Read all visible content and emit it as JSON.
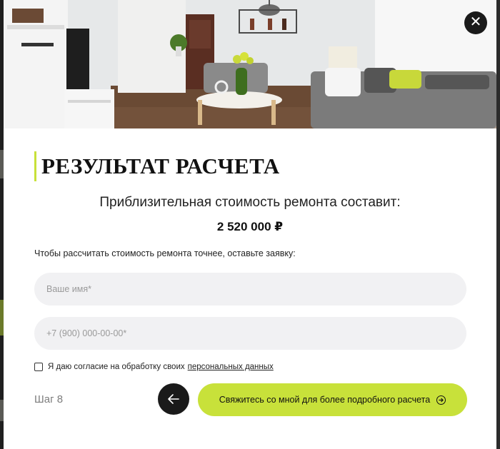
{
  "modal": {
    "title": "РЕЗУЛЬТАТ РАСЧЕТА",
    "subtitle": "Приблизительная стоимость ремонта составит:",
    "price": "2 520 000 ₽",
    "hint": "Чтобы рассчитать стоимость ремонта точнее, оставьте заявку:"
  },
  "form": {
    "name_placeholder": "Ваше имя*",
    "phone_placeholder": "+7 (900) 000-00-00*",
    "consent_text": "Я даю согласие на обработку своих",
    "consent_link": "персональных данных"
  },
  "footer": {
    "step": "Шаг 8",
    "submit_label": "Свяжитесь со мной для более подробного расчета"
  },
  "icons": {
    "close": "close-icon",
    "back": "arrow-left-icon",
    "submit": "arrow-right-circle-icon"
  },
  "colors": {
    "accent": "#c8e13a",
    "dark": "#1a1a1a",
    "field_bg": "#f1f1f3"
  }
}
